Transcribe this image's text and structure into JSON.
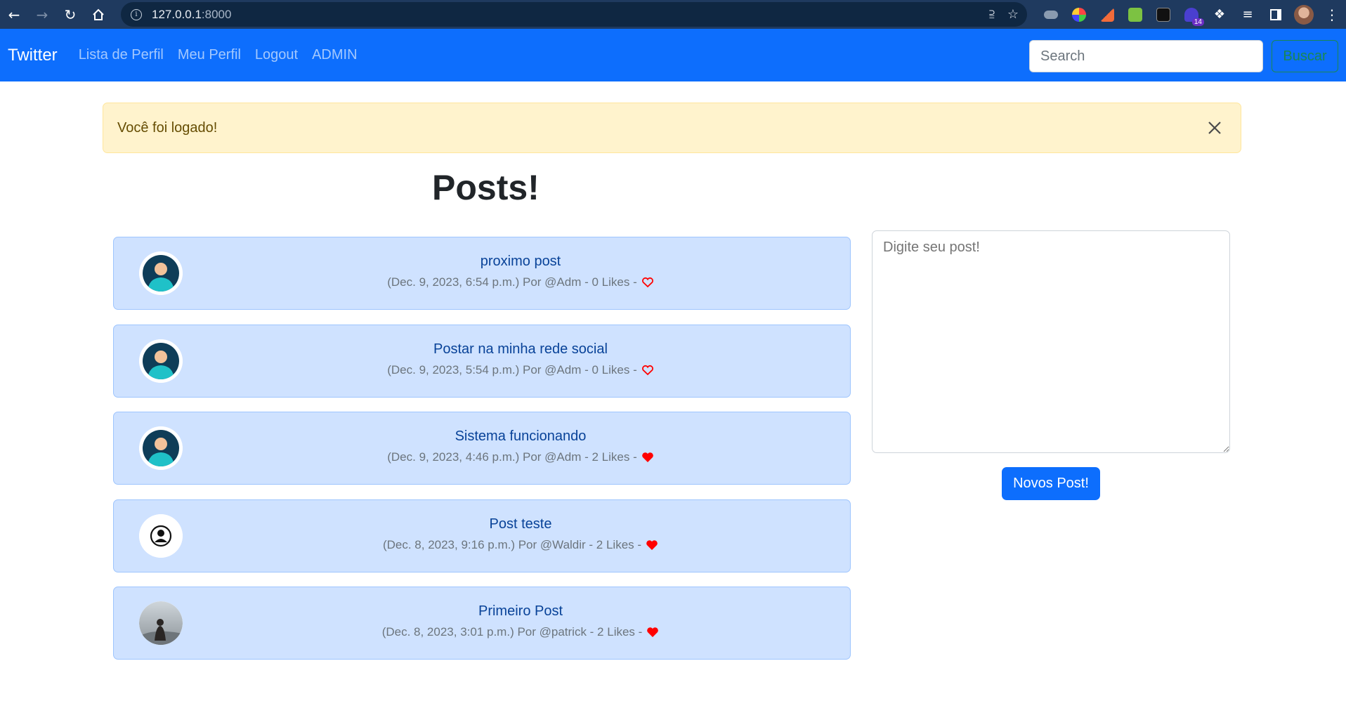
{
  "browser": {
    "url_host": "127.0.0.1",
    "url_port": ":8000",
    "extension_badge": "14"
  },
  "navbar": {
    "brand": "Twitter",
    "links": [
      "Lista de Perfil",
      "Meu Perfil",
      "Logout",
      "ADMIN"
    ],
    "search_placeholder": "Search",
    "search_button": "Buscar"
  },
  "alert": {
    "message": "Você foi logado!"
  },
  "page_title": "Posts!",
  "posts": [
    {
      "title": "proximo post",
      "meta": "(Dec. 9, 2023, 6:54 p.m.) Por @Adm - 0 Likes -",
      "liked": false,
      "avatar": "default-teal-avatar"
    },
    {
      "title": "Postar na minha rede social",
      "meta": "(Dec. 9, 2023, 5:54 p.m.) Por @Adm - 0 Likes -",
      "liked": false,
      "avatar": "default-teal-avatar"
    },
    {
      "title": "Sistema funcionando",
      "meta": "(Dec. 9, 2023, 4:46 p.m.) Por @Adm - 2 Likes -",
      "liked": true,
      "avatar": "default-teal-avatar"
    },
    {
      "title": "Post teste",
      "meta": "(Dec. 8, 2023, 9:16 p.m.) Por @Waldir - 2 Likes -",
      "liked": true,
      "avatar": "person-outline-avatar"
    },
    {
      "title": "Primeiro Post",
      "meta": "(Dec. 8, 2023, 3:01 p.m.) Por @patrick - 2 Likes -",
      "liked": true,
      "avatar": "photo-avatar"
    }
  ],
  "compose": {
    "placeholder": "Digite seu post!",
    "submit": "Novos Post!"
  },
  "colors": {
    "primary": "#0d6efd",
    "alert_bg": "#fff3cd",
    "post_bg": "#cfe2ff",
    "heart": "#ff0000"
  }
}
